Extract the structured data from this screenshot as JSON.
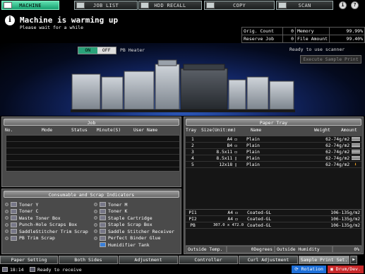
{
  "tabs": [
    {
      "label": "MACHINE",
      "icon": "machine-icon",
      "active": true
    },
    {
      "label": "JOB LIST",
      "icon": "job-list-icon",
      "active": false
    },
    {
      "label": "HDD RECALL",
      "icon": "hdd-icon",
      "active": false
    },
    {
      "label": "COPY",
      "icon": "copy-icon",
      "active": false
    },
    {
      "label": "SCAN",
      "icon": "scan-icon",
      "active": false
    }
  ],
  "top_icons": {
    "info": "i",
    "help": "?"
  },
  "message": {
    "title": "Machine is warming up",
    "subtitle": "Please wait for a while"
  },
  "counters": {
    "orig_count_label": "Orig. Count",
    "orig_count_value": "0",
    "memory_label": "Memory",
    "memory_value": "99.99%",
    "reserve_job_label": "Reserve Job",
    "reserve_job_value": "0",
    "file_amount_label": "File Amount",
    "file_amount_value": "99.40%"
  },
  "machine": {
    "toggle_on": "ON",
    "toggle_off": "OFF",
    "pb_heater": "PB Heater",
    "scanner_status": "Ready to use scanner",
    "sample_print": "Execute Sample Print"
  },
  "job": {
    "title": "Job",
    "columns": [
      "No.",
      "Mode",
      "Status",
      "Minute(S)",
      "User Name"
    ]
  },
  "consumables": {
    "title": "Consumable and Scrap Indicators",
    "left": [
      "Toner Y",
      "Toner C",
      "Waste Toner Box",
      "Punch-Hole Scraps Box",
      "SaddleStitcher Trim Scrap",
      "PB Trim Scrap"
    ],
    "right": [
      "Toner M",
      "Toner K",
      "Staple Cartridge",
      "Staple Scrap Box",
      "Saddle Stitcher Receiver",
      "Perfect Binder Glue",
      "Humidifier Tank"
    ]
  },
  "paper_tray": {
    "title": "Paper Tray",
    "columns": [
      "Tray",
      "Size(Unit:mm)",
      "Name",
      "Weight",
      "Amount"
    ],
    "rows": [
      {
        "tray": "1",
        "size": "A4",
        "name": "Plain",
        "weight": "62-74g/m2"
      },
      {
        "tray": "2",
        "size": "B4",
        "name": "Plain",
        "weight": "62-74g/m2"
      },
      {
        "tray": "3",
        "size": "8.5x11",
        "name": "Plain",
        "weight": "62-74g/m2"
      },
      {
        "tray": "4",
        "size": "8.5x11",
        "name": "Plain",
        "weight": "62-74g/m2"
      },
      {
        "tray": "5",
        "size": "12x18",
        "name": "Plain",
        "weight": "62-74g/m2"
      }
    ],
    "special_rows": [
      {
        "tray": "PI1",
        "size": "A4",
        "name": "Coated-GL",
        "weight": "106-135g/m2"
      },
      {
        "tray": "PI2",
        "size": "A4",
        "name": "Coated-GL",
        "weight": "106-135g/m2"
      },
      {
        "tray": "PB",
        "size": "307.0 x 472.0",
        "name": "Coated-GL",
        "weight": "106-135g/m2"
      }
    ],
    "outside_temp_label": "Outside Temp.",
    "outside_temp_value": "0Degrees",
    "outside_humidity_label": "Outside Humidity",
    "outside_humidity_value": "0%"
  },
  "bottom_buttons": [
    "Paper Setting",
    "Both Sides",
    "Adjustment",
    "Controller",
    "Curl Adjustment",
    "Sample Print Set."
  ],
  "status": {
    "time": "18:14",
    "text": "Ready to receive",
    "rotation": "Rotation",
    "drum_dev": "Drum/Dev."
  }
}
